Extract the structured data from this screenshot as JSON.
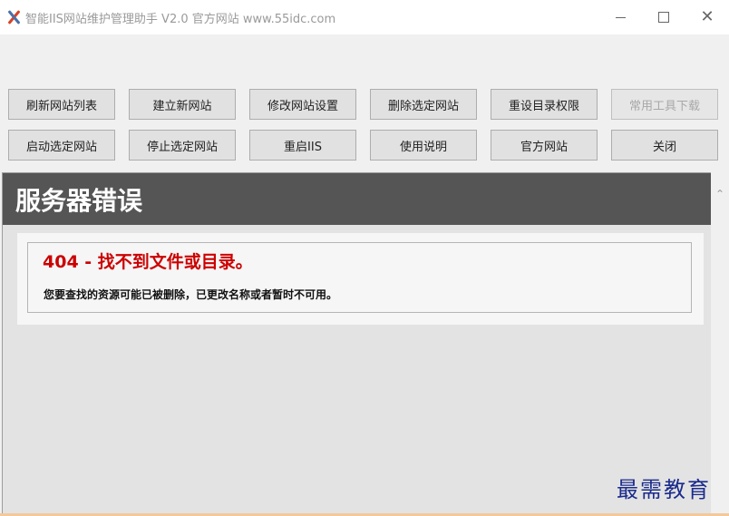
{
  "window": {
    "title": "智能IIS网站维护管理助手 V2.0 官方网站 www.55idc.com",
    "minimize_label": "—",
    "maximize_label": "☐",
    "close_label": "✕"
  },
  "toolbar": {
    "row1": [
      {
        "label": "刷新网站列表",
        "enabled": true
      },
      {
        "label": "建立新网站",
        "enabled": true
      },
      {
        "label": "修改网站设置",
        "enabled": true
      },
      {
        "label": "删除选定网站",
        "enabled": true
      },
      {
        "label": "重设目录权限",
        "enabled": true
      },
      {
        "label": "常用工具下载",
        "enabled": false
      }
    ],
    "row2": [
      {
        "label": "启动选定网站",
        "enabled": true
      },
      {
        "label": "停止选定网站",
        "enabled": true
      },
      {
        "label": "重启IIS",
        "enabled": true
      },
      {
        "label": "使用说明",
        "enabled": true
      },
      {
        "label": "官方网站",
        "enabled": true
      },
      {
        "label": "关闭",
        "enabled": true
      }
    ]
  },
  "web": {
    "header": "服务器错误",
    "error_code": "404 - 找不到文件或目录。",
    "error_desc": "您要查找的资源可能已被删除，已更改名称或者暂时不可用。"
  },
  "scrollbar": {
    "up_glyph": "⌃"
  },
  "watermark": "最需教育",
  "colors": {
    "header_bg": "#555555",
    "error_red": "#cc0000",
    "watermark_blue": "#1a2b8c"
  }
}
